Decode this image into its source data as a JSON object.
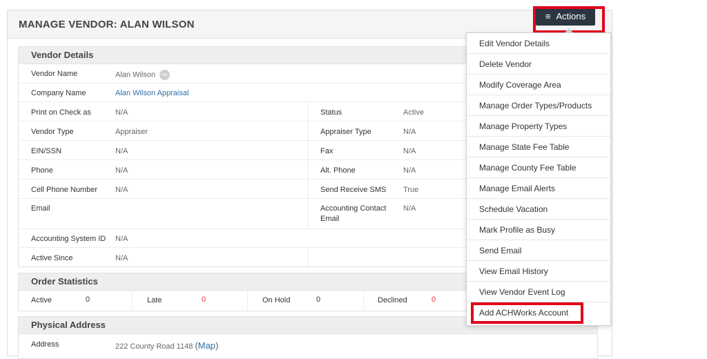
{
  "header": {
    "title": "MANAGE VENDOR: ALAN WILSON",
    "actions_label": "Actions",
    "actions_icon": "hamburger-menu-icon"
  },
  "vendor_details": {
    "heading": "Vendor Details",
    "vendor_name_label": "Vendor Name",
    "vendor_name": "Alan Wilson",
    "vendor_name_icon": "link-icon",
    "company_name_label": "Company Name",
    "company_name": "Alan Wilson Appraisal",
    "print_on_check_label": "Print on Check as",
    "print_on_check": "N/A",
    "status_label": "Status",
    "status": "Active",
    "vendor_type_label": "Vendor Type",
    "vendor_type": "Appraiser",
    "appraiser_type_label": "Appraiser Type",
    "appraiser_type": "N/A",
    "ein_label": "EIN/SSN",
    "ein": "N/A",
    "fax_label": "Fax",
    "fax": "N/A",
    "phone_label": "Phone",
    "phone": "N/A",
    "alt_phone_label": "Alt. Phone",
    "alt_phone": "N/A",
    "cell_label": "Cell Phone Number",
    "cell": "N/A",
    "sms_label": "Send Receive SMS",
    "sms": "True",
    "email_label": "Email",
    "email": "",
    "acct_email_label_1": "Accounting Contact",
    "acct_email_label_2": "Email",
    "acct_email": "N/A",
    "acct_system_label": "Accounting System ID",
    "acct_system": "N/A",
    "active_since_label": "Active Since",
    "active_since": "N/A"
  },
  "order_statistics": {
    "heading": "Order Statistics",
    "active_label": "Active",
    "active": "0",
    "late_label": "Late",
    "late": "0",
    "on_hold_label": "On Hold",
    "on_hold": "0",
    "declined_label": "Declined",
    "declined": "0"
  },
  "physical_address": {
    "heading": "Physical Address",
    "address_label": "Address",
    "address": "222 County Road 1148",
    "map_open": "(",
    "map_link": "Map",
    "map_close": ")"
  },
  "actions_menu": {
    "items": [
      "Edit Vendor Details",
      "Delete Vendor",
      "Modify Coverage Area",
      "Manage Order Types/Products",
      "Manage Property Types",
      "Manage State Fee Table",
      "Manage County Fee Table",
      "Manage Email Alerts",
      "Schedule Vacation",
      "Mark Profile as Busy",
      "Send Email",
      "View Email History",
      "View Vendor Event Log",
      "Add ACHWorks Account"
    ]
  },
  "colors": {
    "highlight": "#e3001b",
    "button_bg": "#2b3642",
    "link": "#2f6ea5",
    "stat_value": "#e53935"
  }
}
